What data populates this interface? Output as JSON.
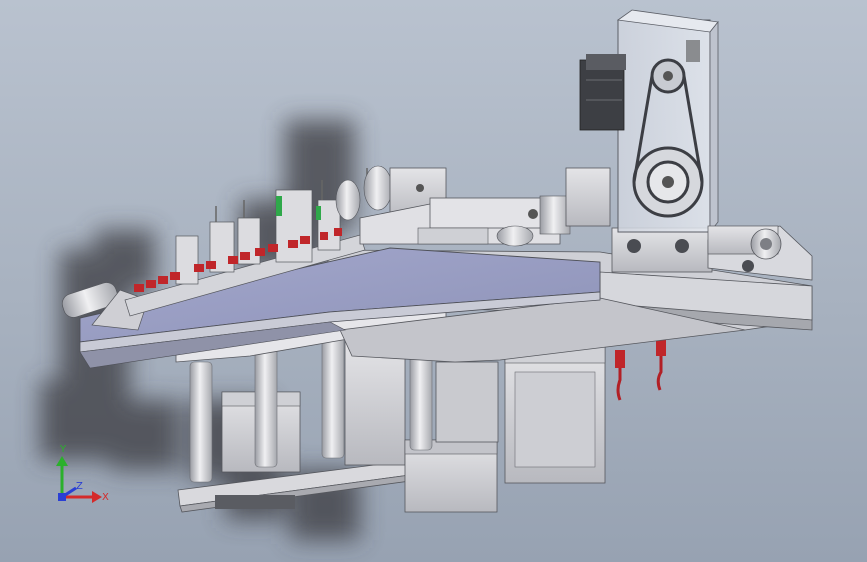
{
  "viewport": {
    "background_top": "#b9c2cf",
    "background_bottom": "#97a2b2"
  },
  "model": {
    "colors": {
      "base_plate_top": "#9ea2c4",
      "base_plate_side": "#c8cad6",
      "frame_light": "#d8d8dc",
      "frame_mid": "#b9bac0",
      "frame_dark": "#8d8f96",
      "clamp_red": "#c0262a",
      "sensor_green": "#2fa84a",
      "motor_dark": "#3d3f44",
      "transparent_cover": "#d4d9e4"
    }
  },
  "axis_triad": {
    "x_label": "X",
    "y_label": "Y",
    "z_label": "Z",
    "x_color": "#d42a2a",
    "y_color": "#2bb02b",
    "z_color": "#2a3fd4"
  }
}
